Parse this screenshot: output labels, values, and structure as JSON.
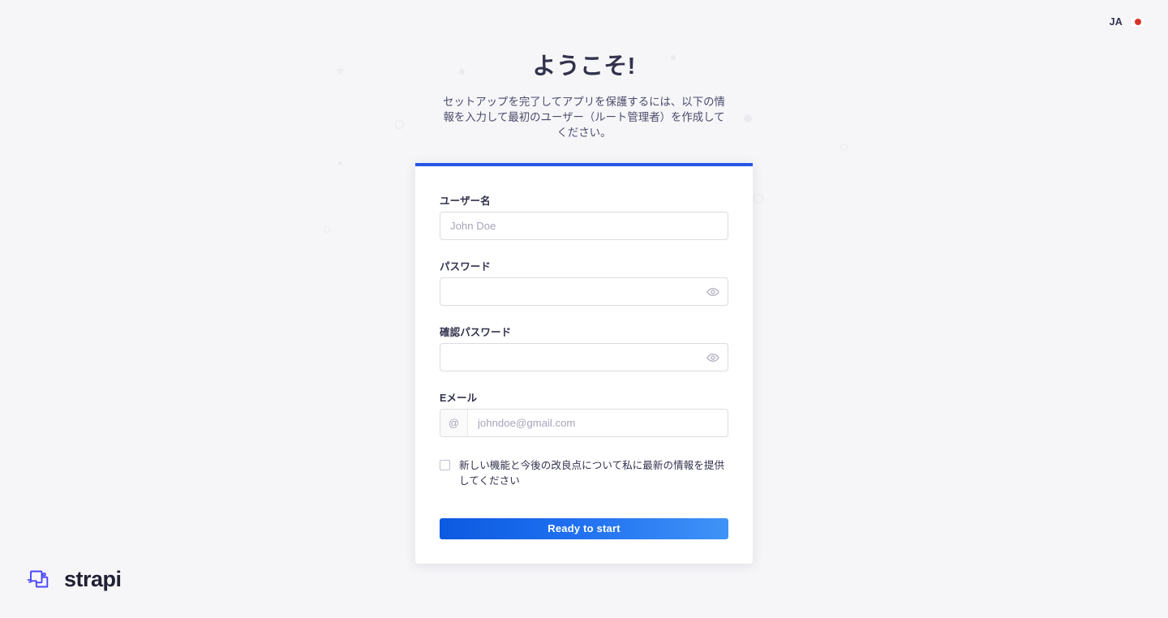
{
  "lang_switcher": {
    "code": "JA",
    "flag_icon": "japan-flag-icon",
    "flag_color": "#d9352a"
  },
  "header": {
    "title": "ようこそ!",
    "subtitle": "セットアップを完了してアプリを保護するには、以下の情報を入力して最初のユーザー（ルート管理者）を作成してください。"
  },
  "form": {
    "accent_color": "#2456e6",
    "fields": {
      "username": {
        "label": "ユーザー名",
        "placeholder": "John Doe",
        "value": ""
      },
      "password": {
        "label": "パスワード",
        "placeholder": "",
        "value": "",
        "toggle_icon": "eye-icon"
      },
      "confirm_password": {
        "label": "確認パスワード",
        "placeholder": "",
        "value": "",
        "toggle_icon": "eye-icon"
      },
      "email": {
        "label": "Eメール",
        "prefix": "@",
        "placeholder": "johndoe@gmail.com",
        "value": ""
      }
    },
    "newsletter": {
      "label": "新しい機能と今後の改良点について私に最新の情報を提供してください",
      "checked": false
    },
    "submit_label": "Ready to start",
    "submit_color": "#1f6ff0"
  },
  "branding": {
    "wordmark": "strapi",
    "logo_icon": "strapi-logo-icon",
    "logo_color": "#4945ff"
  }
}
